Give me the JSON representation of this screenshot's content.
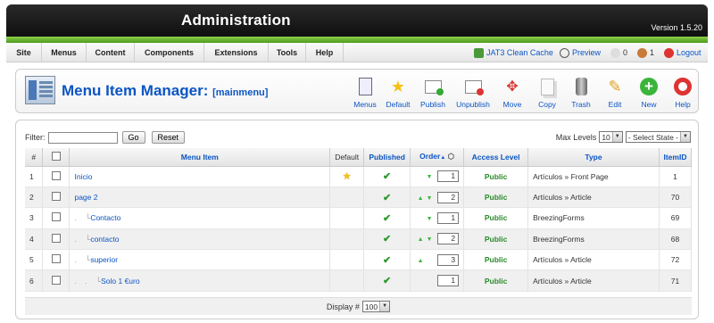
{
  "header": {
    "title": "Administration",
    "version": "Version 1.5.20"
  },
  "menu": [
    "Site",
    "Menus",
    "Content",
    "Components",
    "Extensions",
    "Tools",
    "Help"
  ],
  "status": {
    "cache": "JAT3 Clean Cache",
    "preview": "Preview",
    "messages": "0",
    "users": "1",
    "logout": "Logout"
  },
  "page": {
    "title": "Menu Item Manager:",
    "subtitle": "[mainmenu]"
  },
  "toolbar": [
    "Menus",
    "Default",
    "Publish",
    "Unpublish",
    "Move",
    "Copy",
    "Trash",
    "Edit",
    "New",
    "Help"
  ],
  "filter": {
    "label": "Filter:",
    "value": "",
    "go": "Go",
    "reset": "Reset",
    "max_levels_label": "Max Levels",
    "max_levels": "10",
    "state": "- Select State -"
  },
  "table": {
    "headers": [
      "#",
      "",
      "Menu Item",
      "Default",
      "Published",
      "Order",
      "Access Level",
      "Type",
      "ItemID"
    ],
    "rows": [
      {
        "num": "1",
        "indent": "",
        "name": "Inicio",
        "default": true,
        "order": "1",
        "access": "Public",
        "type": "Artículos » Front Page",
        "id": "1"
      },
      {
        "num": "2",
        "indent": "",
        "name": "page 2",
        "default": false,
        "order": "2",
        "access": "Public",
        "type": "Artículos » Article",
        "id": "70"
      },
      {
        "num": "3",
        "indent": ".    └",
        "name": "Contacto",
        "default": false,
        "order": "1",
        "access": "Public",
        "type": "BreezingForms",
        "id": "69"
      },
      {
        "num": "4",
        "indent": ".    └",
        "name": "contacto",
        "default": false,
        "order": "2",
        "access": "Public",
        "type": "BreezingForms",
        "id": "68"
      },
      {
        "num": "5",
        "indent": ".    └",
        "name": "superior",
        "default": false,
        "order": "3",
        "access": "Public",
        "type": "Artículos » Article",
        "id": "72"
      },
      {
        "num": "6",
        "indent": ".    .    └",
        "name": "Solo 1 €uro",
        "default": false,
        "order": "1",
        "access": "Public",
        "type": "Artículos » Article",
        "id": "71"
      }
    ]
  },
  "footer": {
    "display_label": "Display #",
    "display": "100"
  }
}
